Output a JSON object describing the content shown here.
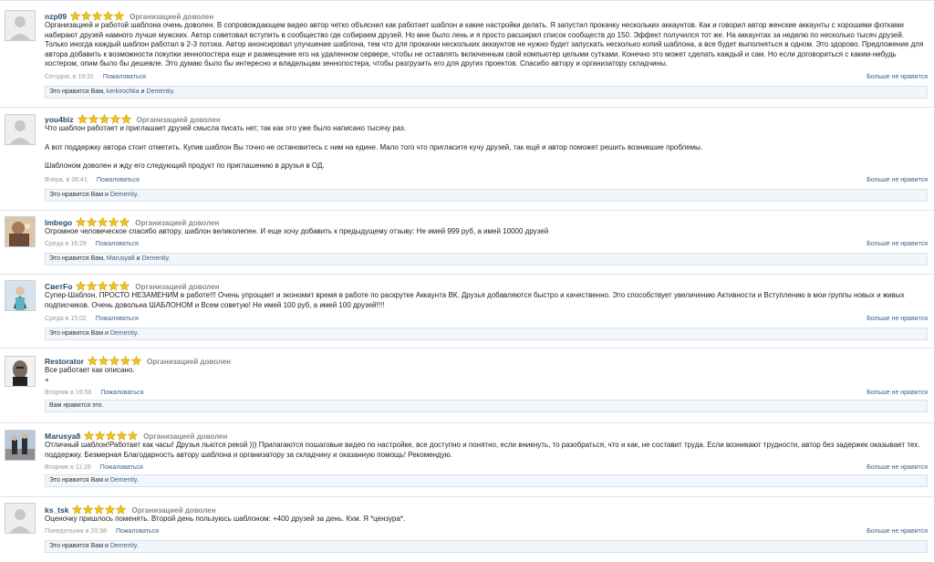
{
  "rating_label": "Организацией доволен",
  "report_label": "Пожаловаться",
  "dislike_label": "Больше не нравится",
  "star_color": "#f2c31b",
  "reviews": [
    {
      "user": "nzp09",
      "paragraphs": [
        "Организацией и работой шаблона очень доволен. В сопровождающем видео автор четко объяснил как работает шаблон и какие настройки делать. Я запустил прокачку нескольких аккаунтов. Как и говорил автор женские аккаунты с хорошими фотками набирают друзей намного лучше мужских. Автор советовал вступить в сообщество где собираем друзей. Но мне было лень и я просто расширил список сообществ до 150. Эффект получился тот же. На аккаунтах за неделю по несколько тысяч друзей. Только иногда каждый шаблон работал в 2-3 потока. Автор анонсировал улучшение шаблона, тем что для прокачки нескольких аккаунтов не нужно будет запускать несколько копий шаблона, а все будет выполняться в одном. Это здорово. Предложение для автора добавить к возможности покупки зеннопостера еще и размещение его на удаленном сервере, чтобы не оставлять включенным свой компьютер целыми сутками. Конечно это может сделать каждый и сам. Но если договориться с каким-нибудь хостером, опим было бы дешевле. Это думаю было бы интересно и владельцам зеннопостера, чтобы разгрузить его для других проектов. Спасибо автору и организатору складчины."
      ],
      "date": "Сегодня, в 19:31",
      "likes_prefix": "Это нравится Вам, ",
      "likes_links": [
        "kerkirochka",
        "Dementiy"
      ],
      "likes_sep": " и "
    },
    {
      "user": "you4biz",
      "paragraphs": [
        "Что шаблон работает и приглашает друзей смысла писать нет, так как это уже было написано тысячу раз.",
        "А вот поддержку автора стоит отметить. Купив шаблон Вы точно не остановитесь с ним на едине. Мало того что пригласите кучу друзей, так ещё и автор поможет решить возникшие проблемы.",
        "Шаблоном доволен и жду его следующий продукт по приглашению в друзья в ОД."
      ],
      "date": "Вчера, в 08:41",
      "likes_prefix": "Это нравится Вам и ",
      "likes_links": [
        "Dementiy"
      ],
      "likes_sep": ""
    },
    {
      "user": "lmbego",
      "paragraphs": [
        "Огромное человеческое спасибо автору, шаблон великолепен. И еще хочу добавить к предыдущему отзыву: Не имей 999 руб, а имей 10000 друзей"
      ],
      "date": "Среда в 16:29",
      "likes_prefix": "Это нравится Вам, ",
      "likes_links": [
        "Marusya8",
        "Dementiy"
      ],
      "likes_sep": " и "
    },
    {
      "user": "СветFo",
      "paragraphs": [
        "Супер-Шаблон. ПРОСТО НЕЗАМЕНИМ в работе!!! Очень упрощает и экономит время в работе по раскрутке Аккаунта ВК. Друзья добавляются быстро и качественно. Это способствует увеличению Активности и Вступлению в мои группы новых и живых подписчиков. Очень довольна ШАБЛОНОМ и Всем советую! Не имей 100 руб, а имей 100 друзей!!!!"
      ],
      "date": "Среда в 15:02",
      "likes_prefix": "Это нравится Вам и ",
      "likes_links": [
        "Dementiy"
      ],
      "likes_sep": ""
    },
    {
      "user": "Restorator",
      "paragraphs": [
        "Все работает как описано.",
        "+"
      ],
      "date": "Вторник в 16:58",
      "likes_prefix": "Вам нравится это.",
      "likes_links": [],
      "likes_sep": ""
    },
    {
      "user": "Marusya8",
      "paragraphs": [
        "Отличный шаблон!Работает как часы! Друзья льются рекой ))) Прилагаются пошаговые видео по настройке, все доступно и понятно, если вникнуть, то разобраться, что и как, не составит труда. Если возникают трудности, автор без задержек оказывает тех. поддержку. Безмерная Благодарность автору шаблона и организатору за складчину и оказанную помощь! Рекомендую."
      ],
      "date": "Вторник в 11:26",
      "likes_prefix": "Это нравится Вам и ",
      "likes_links": [
        "Dementiy"
      ],
      "likes_sep": ""
    },
    {
      "user": "ks_tsk",
      "paragraphs": [
        "Оценочку пришлось поменять. Второй день пользуюсь шаблоном: +400 друзей за день. Кхм. Я *цензура*."
      ],
      "date": "Понедельник в 20:38",
      "likes_prefix": "Это нравится Вам и ",
      "likes_links": [
        "Dementiy"
      ],
      "likes_sep": ""
    }
  ]
}
